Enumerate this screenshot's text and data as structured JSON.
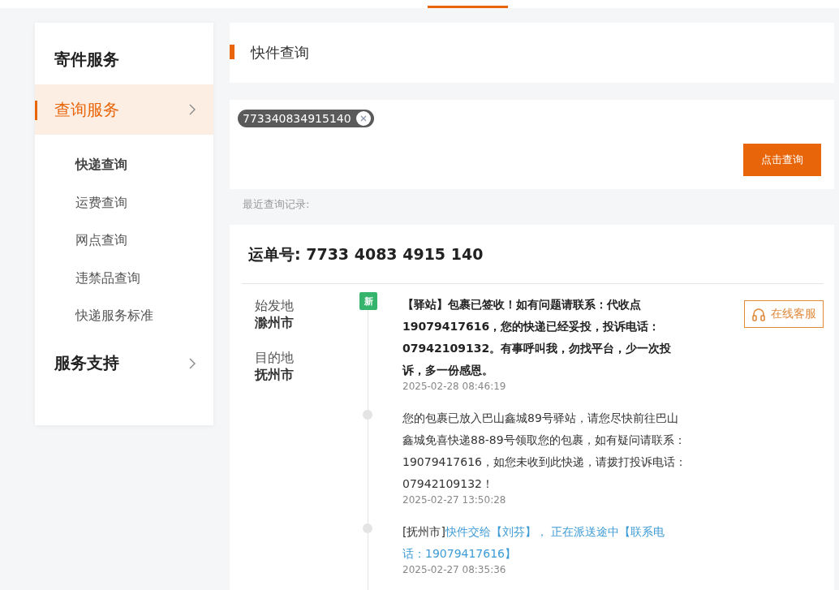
{
  "top_tabs": [
    {
      "selected": true
    }
  ],
  "sidebar": {
    "items": [
      {
        "label": "寄件服务",
        "kind": "plain",
        "selected": false
      },
      {
        "label": "查询服务",
        "kind": "chevron",
        "selected": true,
        "children": [
          {
            "label": "快递查询",
            "selected": true
          },
          {
            "label": "运费查询",
            "selected": false
          },
          {
            "label": "网点查询",
            "selected": false
          },
          {
            "label": "违禁品查询",
            "selected": false
          },
          {
            "label": "快递服务标准",
            "selected": false
          }
        ]
      },
      {
        "label": "服务支持",
        "kind": "chevron",
        "selected": false
      }
    ]
  },
  "page_title": "快件查询",
  "search": {
    "tags": [
      "773340834915140"
    ],
    "button": "点击查询",
    "recent_label": "最近查询记录:"
  },
  "result": {
    "waybill_label": "运单号:",
    "waybill_number": "7733 4083 4915 140",
    "origin": {
      "label": "始发地",
      "city": "滁州市"
    },
    "destination": {
      "label": "目的地",
      "city": "抚州市"
    },
    "service_button": "在线客服",
    "events": [
      {
        "latest": true,
        "badge": "新",
        "text": "【驿站】包裹已签收！如有问题请联系：代收点19079417616，您的快递已经妥投，投诉电话：07942109132。有事呼叫我，勿找平台，少一次投诉，多一份感恩。",
        "time": "2025-02-28 08:46:19"
      },
      {
        "latest": false,
        "text": "您的包裹已放入巴山鑫城89号驿站，请您尽快前往巴山鑫城免喜快递88-89号领取您的包裹，如有疑问请联系：19079417616，如您未收到此快递，请拨打投诉电话：07942109132！",
        "time": "2025-02-27 13:50:28"
      },
      {
        "latest": false,
        "location": "[抚州市]",
        "text": "快件交给【刘芬】， 正在派送途中【联系电话：19079417616】",
        "time": "2025-02-27 08:35:36"
      }
    ]
  }
}
